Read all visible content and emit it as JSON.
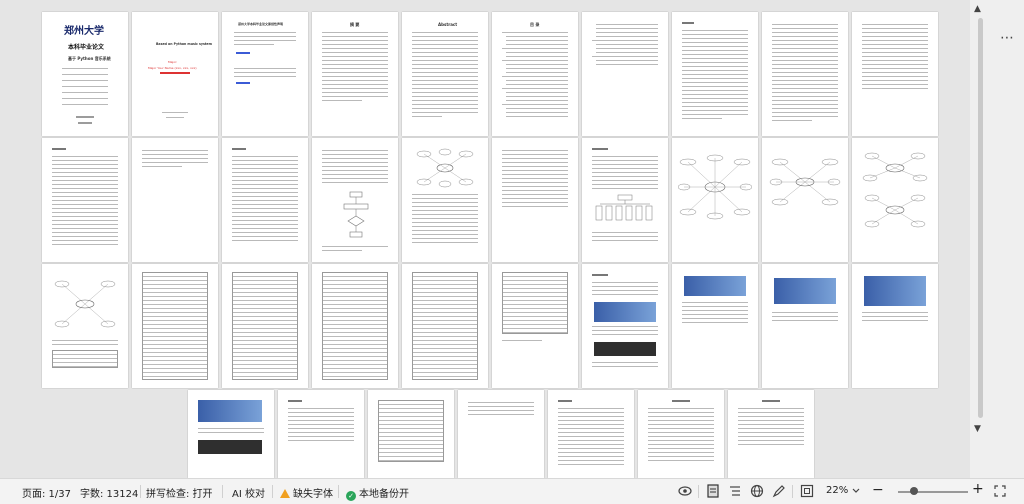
{
  "status_bar": {
    "page_label": "页面: 1/37",
    "word_count": "字数: 13124",
    "spell_check": "拼写检查: 打开",
    "ai_proofread": "AI 校对",
    "missing_font": "缺失字体",
    "local_backup": "本地备份开",
    "zoom": "22%"
  },
  "cover": {
    "logo_text": "郑州大学",
    "title": "本科毕业论文",
    "subtitle": "基于 Python 音乐系统"
  },
  "page2": {
    "title": "Based on Python music system",
    "red_line1": "Major:",
    "red_line2": "Major Your Name  (xxx, xxx, xxx)"
  },
  "page3": {
    "title": "郑州大学本科毕业论文原创性声明"
  },
  "page4": {
    "title": "摘 要"
  },
  "page5": {
    "title": "Abstract"
  },
  "page6": {
    "title": "目 录"
  },
  "icons": {
    "scroll_up": "▲",
    "scroll_down": "▼",
    "more": "⋯"
  }
}
